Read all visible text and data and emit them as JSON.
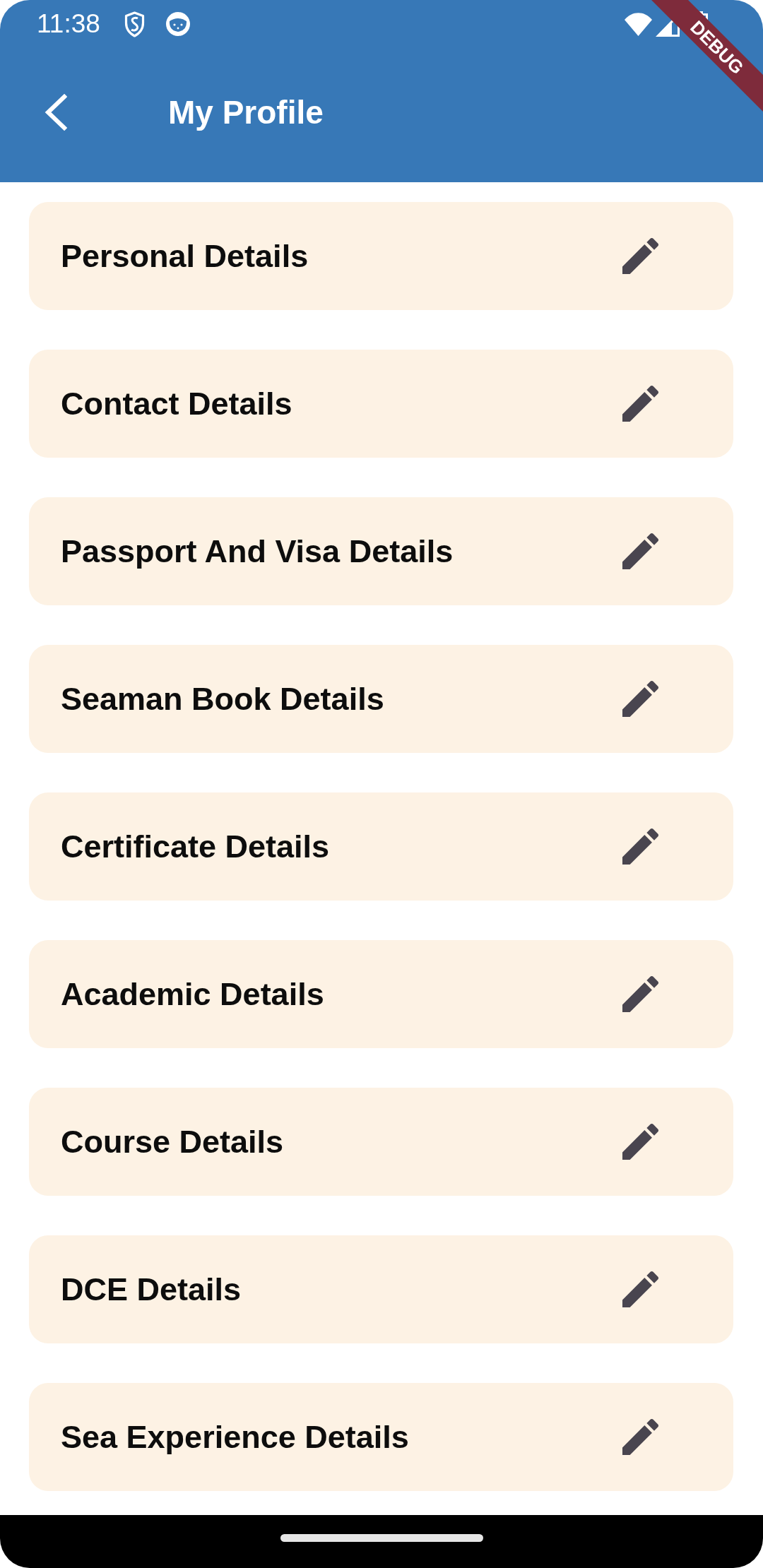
{
  "status_bar": {
    "time": "11:38"
  },
  "app_bar": {
    "title": "My Profile"
  },
  "debug_banner": {
    "label": "DEBUG"
  },
  "sections": [
    {
      "title": "Personal Details"
    },
    {
      "title": "Contact Details"
    },
    {
      "title": "Passport And Visa Details"
    },
    {
      "title": "Seaman Book Details"
    },
    {
      "title": "Certificate Details"
    },
    {
      "title": "Academic Details"
    },
    {
      "title": "Course Details"
    },
    {
      "title": "DCE Details"
    },
    {
      "title": "Sea Experience Details"
    }
  ]
}
